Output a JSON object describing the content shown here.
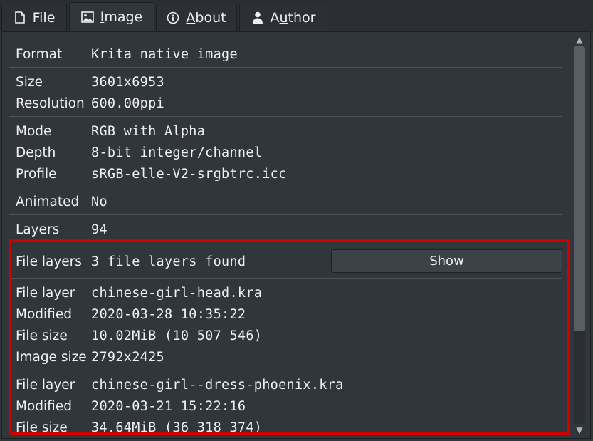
{
  "tabs": [
    {
      "label_pre": "",
      "label_ul": "",
      "label_post": "File",
      "icon": "document-icon"
    },
    {
      "label_pre": "",
      "label_ul": "I",
      "label_post": "mage",
      "icon": "image-icon"
    },
    {
      "label_pre": "",
      "label_ul": "A",
      "label_post": "bout",
      "icon": "info-icon"
    },
    {
      "label_pre": "A",
      "label_ul": "u",
      "label_post": "thor",
      "icon": "user-icon"
    }
  ],
  "active_tab": 1,
  "info": {
    "format": {
      "label": "Format",
      "value": "Krita native image"
    },
    "size": {
      "label": "Size",
      "value": "3601x6953"
    },
    "resolution": {
      "label": "Resolution",
      "value": "600.00ppi"
    },
    "mode": {
      "label": "Mode",
      "value": "RGB with Alpha"
    },
    "depth": {
      "label": "Depth",
      "value": "8-bit integer/channel"
    },
    "profile": {
      "label": "Profile",
      "value": "sRGB-elle-V2-srgbtrc.icc"
    },
    "animated": {
      "label": "Animated",
      "value": "No"
    },
    "layers": {
      "label": "Layers",
      "value": "94"
    },
    "file_layers": {
      "label": "File layers",
      "value": "3 file layers found"
    }
  },
  "show_button": {
    "pre": "Sho",
    "ul": "w",
    "post": ""
  },
  "file_layer_entries": [
    {
      "file_layer": {
        "label": "File layer",
        "value": "chinese-girl-head.kra"
      },
      "modified": {
        "label": "Modified",
        "value": "2020-03-28 10:35:22"
      },
      "file_size": {
        "label": "File size",
        "value": "10.02MiB (10 507 546)"
      },
      "image_size": {
        "label": "Image size",
        "value": "2792x2425"
      }
    },
    {
      "file_layer": {
        "label": "File layer",
        "value": "chinese-girl--dress-phoenix.kra"
      },
      "modified": {
        "label": "Modified",
        "value": "2020-03-21 15:22:16"
      },
      "file_size": {
        "label": "File size",
        "value": "34.64MiB (36 318 374)"
      }
    }
  ],
  "colors": {
    "background": "#31363b",
    "text": "#eff0f1",
    "highlight": "#d00000"
  }
}
